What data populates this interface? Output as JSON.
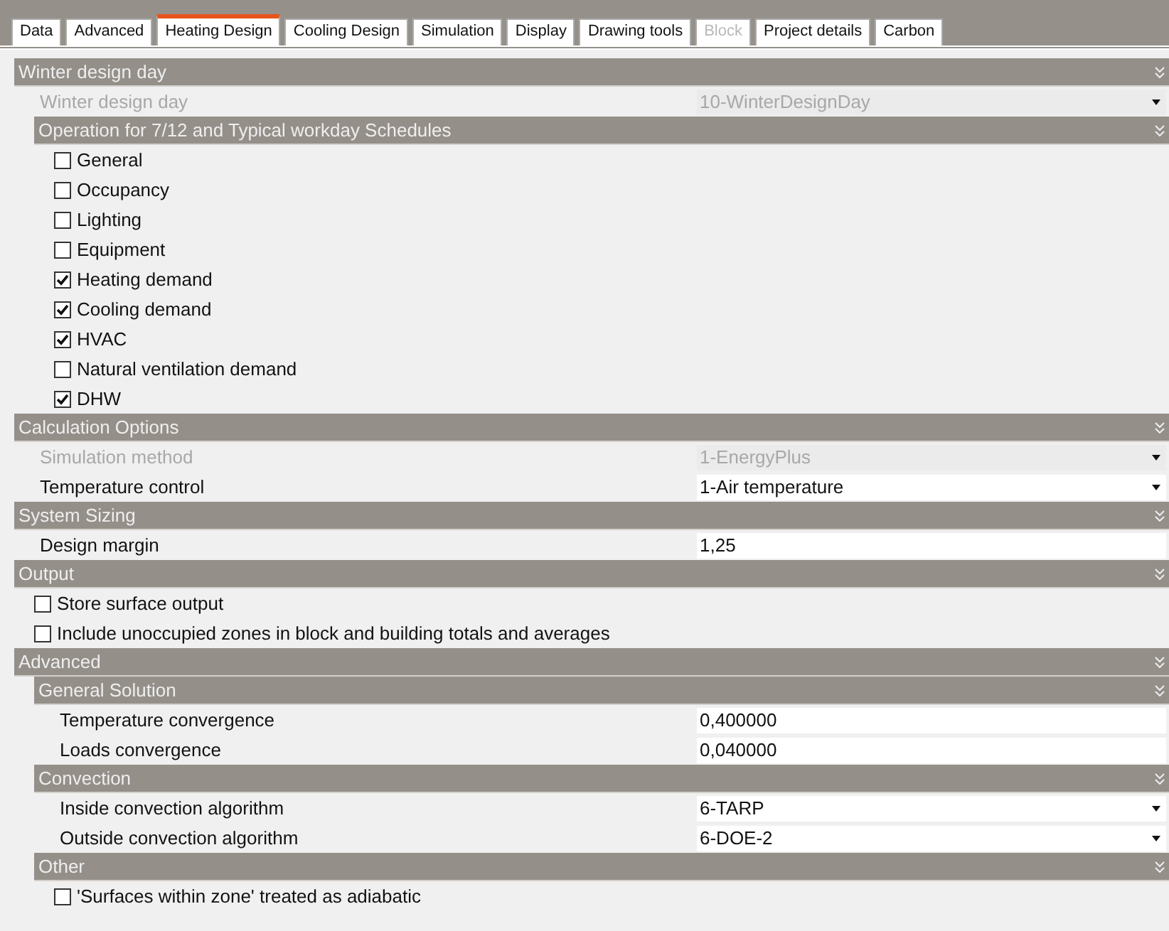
{
  "tabs": [
    {
      "label": "Data",
      "selected": false,
      "disabled": false
    },
    {
      "label": "Advanced",
      "selected": false,
      "disabled": false
    },
    {
      "label": "Heating Design",
      "selected": true,
      "disabled": false
    },
    {
      "label": "Cooling Design",
      "selected": false,
      "disabled": false
    },
    {
      "label": "Simulation",
      "selected": false,
      "disabled": false
    },
    {
      "label": "Display",
      "selected": false,
      "disabled": false
    },
    {
      "label": "Drawing tools",
      "selected": false,
      "disabled": false
    },
    {
      "label": "Block",
      "selected": false,
      "disabled": true
    },
    {
      "label": "Project details",
      "selected": false,
      "disabled": false
    },
    {
      "label": "Carbon",
      "selected": false,
      "disabled": false
    }
  ],
  "sections": [
    {
      "kind": "header",
      "title": "Winter design day",
      "children": [
        {
          "kind": "dropdown",
          "label": "Winter design day",
          "value": "10-WinterDesignDay",
          "disabled": true
        },
        {
          "kind": "header",
          "title": "Operation for 7/12 and Typical workday Schedules",
          "children": [
            {
              "kind": "check",
              "label": "General",
              "checked": false
            },
            {
              "kind": "check",
              "label": "Occupancy",
              "checked": false
            },
            {
              "kind": "check",
              "label": "Lighting",
              "checked": false
            },
            {
              "kind": "check",
              "label": "Equipment",
              "checked": false
            },
            {
              "kind": "check",
              "label": "Heating demand",
              "checked": true
            },
            {
              "kind": "check",
              "label": "Cooling demand",
              "checked": true
            },
            {
              "kind": "check",
              "label": "HVAC",
              "checked": true
            },
            {
              "kind": "check",
              "label": "Natural ventilation demand",
              "checked": false
            },
            {
              "kind": "check",
              "label": "DHW",
              "checked": true
            }
          ]
        }
      ]
    },
    {
      "kind": "header",
      "title": "Calculation Options",
      "children": [
        {
          "kind": "dropdown",
          "label": "Simulation method",
          "value": "1-EnergyPlus",
          "disabled": true
        },
        {
          "kind": "dropdown",
          "label": "Temperature control",
          "value": "1-Air temperature",
          "disabled": false
        }
      ]
    },
    {
      "kind": "header",
      "title": "System Sizing",
      "children": [
        {
          "kind": "text",
          "label": "Design margin",
          "value": "1,25",
          "disabled": false
        }
      ]
    },
    {
      "kind": "header",
      "title": "Output",
      "children": [
        {
          "kind": "check",
          "label": "Store surface output",
          "checked": false
        },
        {
          "kind": "check",
          "label": "Include unoccupied zones in block and building totals and averages",
          "checked": false
        }
      ]
    },
    {
      "kind": "header",
      "title": "Advanced",
      "children": [
        {
          "kind": "header",
          "title": "General Solution",
          "children": [
            {
              "kind": "text",
              "label": "Temperature convergence",
              "value": "0,400000",
              "disabled": false
            },
            {
              "kind": "text",
              "label": "Loads convergence",
              "value": "0,040000",
              "disabled": false
            }
          ]
        },
        {
          "kind": "header",
          "title": "Convection",
          "children": [
            {
              "kind": "dropdown",
              "label": "Inside convection algorithm",
              "value": "6-TARP",
              "disabled": false
            },
            {
              "kind": "dropdown",
              "label": "Outside convection algorithm",
              "value": "6-DOE-2",
              "disabled": false
            }
          ]
        },
        {
          "kind": "header",
          "title": "Other",
          "children": [
            {
              "kind": "check",
              "label": "'Surfaces within zone' treated as adiabatic",
              "checked": false
            }
          ]
        }
      ]
    }
  ]
}
